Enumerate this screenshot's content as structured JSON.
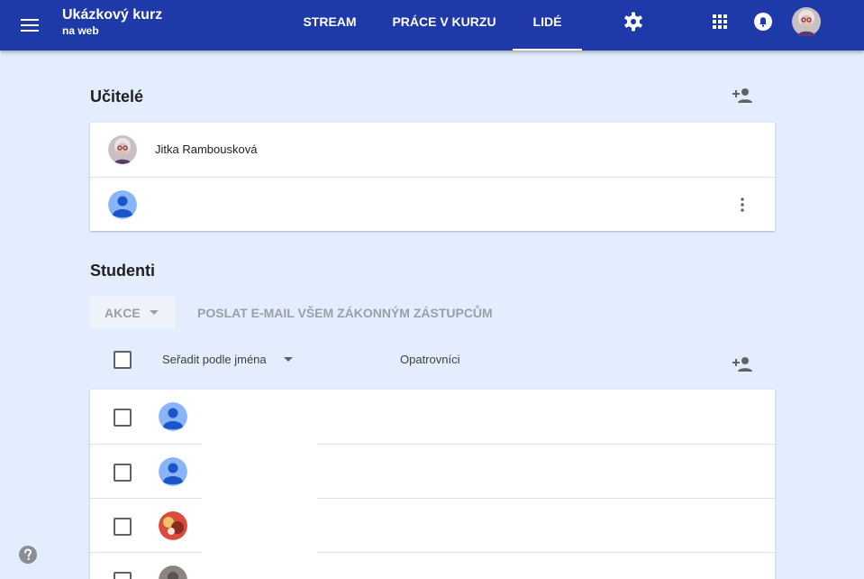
{
  "header": {
    "course_title": "Ukázkový kurz",
    "course_subtitle": "na web",
    "tabs": [
      {
        "label": "STREAM"
      },
      {
        "label": "PRÁCE V KURZU"
      },
      {
        "label": "LIDÉ",
        "active": true
      }
    ],
    "icons": {
      "menu": "menu-icon",
      "settings": "gear-icon",
      "apps": "apps-grid-icon",
      "notifications": "bell-icon",
      "account": "account-avatar"
    }
  },
  "teachers": {
    "title": "Učitelé",
    "invite_icon": "person-add-icon",
    "rows": [
      {
        "name": "Jitka Rambousková",
        "avatar": "photo"
      },
      {
        "name": "",
        "avatar": "default-person",
        "menu_icon": "more-vert-icon"
      }
    ]
  },
  "students": {
    "title": "Studenti",
    "actions_label": "AKCE",
    "email_guardians_label": "POSLAT E-MAIL VŠEM ZÁKONNÝM ZÁSTUPCŮM",
    "sort_label": "Seřadit podle jména",
    "guardians_label": "Opatrovníci",
    "invite_icon": "person-add-icon",
    "rows": [
      {
        "avatar": "default-person"
      },
      {
        "avatar": "default-person"
      },
      {
        "avatar": "photo-red"
      },
      {
        "avatar": "photo-gray"
      }
    ]
  },
  "footer": {
    "help_icon": "help-icon"
  },
  "colors": {
    "header": "#1e39a8",
    "background": "#e3edfd",
    "accent_blue": "#4285f4",
    "muted_text": "#9aa0a6"
  }
}
